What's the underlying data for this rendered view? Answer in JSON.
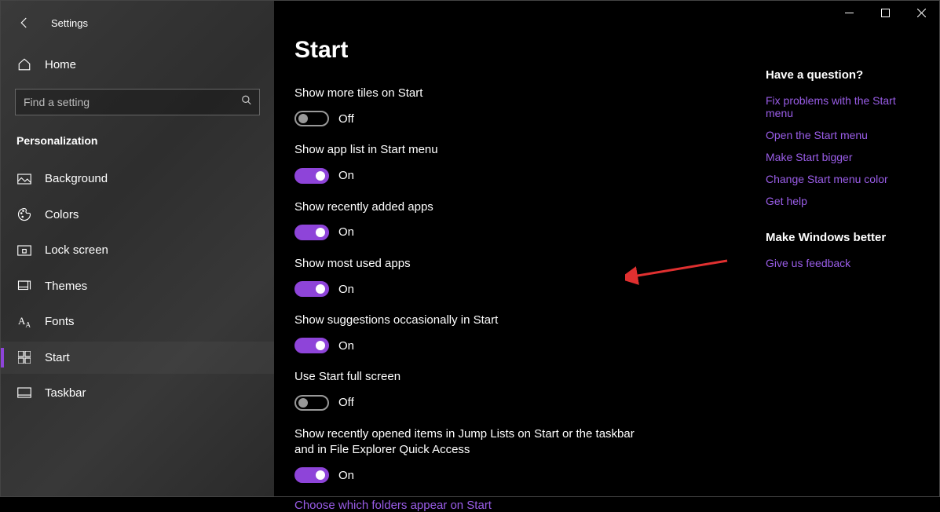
{
  "window": {
    "title": "Settings"
  },
  "sidebar": {
    "home_label": "Home",
    "search_placeholder": "Find a setting",
    "category": "Personalization",
    "items": [
      {
        "label": "Background",
        "icon": "picture"
      },
      {
        "label": "Colors",
        "icon": "palette"
      },
      {
        "label": "Lock screen",
        "icon": "lock-screen"
      },
      {
        "label": "Themes",
        "icon": "themes"
      },
      {
        "label": "Fonts",
        "icon": "fonts"
      },
      {
        "label": "Start",
        "icon": "start",
        "active": true
      },
      {
        "label": "Taskbar",
        "icon": "taskbar"
      }
    ]
  },
  "page": {
    "title": "Start",
    "settings": [
      {
        "label": "Show more tiles on Start",
        "state": "Off",
        "on": false
      },
      {
        "label": "Show app list in Start menu",
        "state": "On",
        "on": true
      },
      {
        "label": "Show recently added apps",
        "state": "On",
        "on": true
      },
      {
        "label": "Show most used apps",
        "state": "On",
        "on": true
      },
      {
        "label": "Show suggestions occasionally in Start",
        "state": "On",
        "on": true
      },
      {
        "label": "Use Start full screen",
        "state": "Off",
        "on": false
      },
      {
        "label": "Show recently opened items in Jump Lists on Start or the taskbar and in File Explorer Quick Access",
        "state": "On",
        "on": true
      }
    ],
    "footer_link": "Choose which folders appear on Start"
  },
  "help": {
    "question_heading": "Have a question?",
    "links": [
      "Fix problems with the Start menu",
      "Open the Start menu",
      "Make Start bigger",
      "Change Start menu color",
      "Get help"
    ],
    "feedback_heading": "Make Windows better",
    "feedback_link": "Give us feedback"
  }
}
